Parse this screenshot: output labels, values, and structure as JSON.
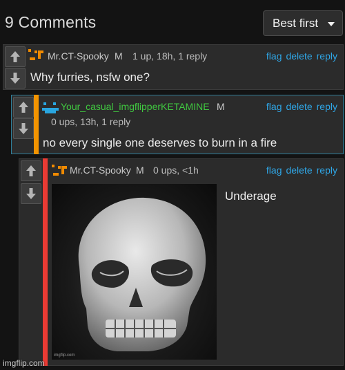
{
  "header": {
    "count_title": "9 Comments",
    "sort_label": "Best first"
  },
  "comments": [
    {
      "username": "Mr.CT-Spooky",
      "mod_badge": "M",
      "meta": "1 up, 18h, 1 reply",
      "text": "Why furries, nsfw one?",
      "actions": {
        "flag": "flag",
        "delete": "delete",
        "reply": "reply"
      }
    },
    {
      "username": "Your_casual_imgflipperKETAMINE",
      "mod_badge": "M",
      "meta": "0 ups, 13h, 1 reply",
      "text": "no every single one deserves to burn in a fire",
      "actions": {
        "flag": "flag",
        "delete": "delete",
        "reply": "reply"
      }
    },
    {
      "username": "Mr.CT-Spooky",
      "mod_badge": "M",
      "meta": "0 ups, <1h",
      "text": "Underage",
      "image_watermark": "imgflip.com",
      "actions": {
        "flag": "flag",
        "delete": "delete",
        "reply": "reply"
      }
    }
  ],
  "footer": {
    "watermark": "imgflip.com"
  },
  "colors": {
    "accent_link": "#2fa6e6",
    "username_green": "#40c840",
    "thread_bar_orange": "#f39400",
    "thread_bar_red": "#ea3b34",
    "highlight_border": "#2f7f9a"
  }
}
